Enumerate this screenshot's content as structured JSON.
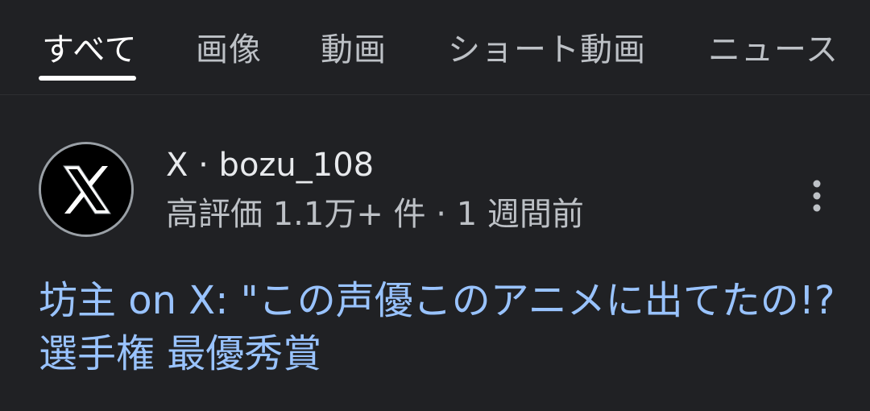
{
  "tabs": [
    {
      "label": "すべて",
      "active": true
    },
    {
      "label": "画像",
      "active": false
    },
    {
      "label": "動画",
      "active": false
    },
    {
      "label": "ショート動画",
      "active": false
    },
    {
      "label": "ニュース",
      "active": false
    }
  ],
  "result": {
    "avatar_icon": "x-logo-icon",
    "source": "X · bozu_108",
    "meta": "高評価 1.1万+ 件 · 1 週間前",
    "title": "坊主 on X: \"この声優このアニメに出てたの!?選手権 最優秀賞",
    "more_icon": "more-vert-icon"
  },
  "colors": {
    "background": "#202124",
    "title_link": "#99c3ff",
    "tab_text": "#bdc1c6",
    "active_tab": "#ffffff"
  }
}
